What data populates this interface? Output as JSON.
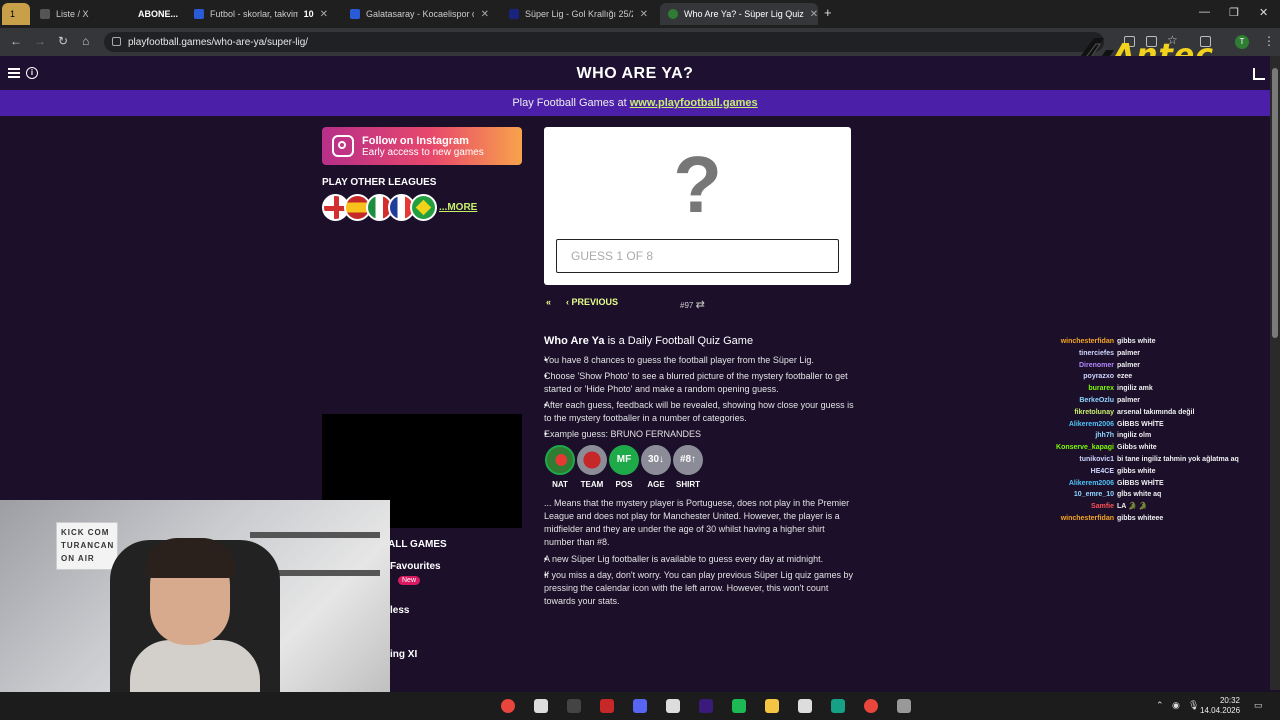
{
  "browser": {
    "tabs": [
      {
        "label": "1",
        "fav_color": "#ffb300",
        "title": "Liste / X",
        "has_close": false
      },
      {
        "label": "ABONE...",
        "fav_color": "#444",
        "title": "",
        "has_close": false
      },
      {
        "label": "Futbol - skorlar, takvim & c",
        "fav_color": "#2a5bd7",
        "title": "10",
        "has_close": true
      },
      {
        "label": "Galatasaray - Kocaelispor canlı",
        "fav_color": "#2a5bd7",
        "title": "",
        "has_close": true
      },
      {
        "label": "Süper Lig - Gol Krallığı 25/26 | T",
        "fav_color": "#1a237e",
        "title": "",
        "has_close": true
      },
      {
        "label": "Who Are Ya? - Süper Lig Quiz",
        "fav_color": "#2e7d32",
        "title": "",
        "has_close": true
      }
    ],
    "new_tab": "+",
    "url": "playfootball.games/who-are-ya/super-lig/",
    "profile_initial": "T",
    "window_controls": [
      "—",
      "❐",
      "✕"
    ]
  },
  "site": {
    "title": "WHO ARE YA?",
    "promo_prefix": "Play Football Games at ",
    "promo_link": "www.playfootball.games"
  },
  "left": {
    "insta_title": "Follow on Instagram",
    "insta_sub": "Early access to new games",
    "leagues_title": "PLAY OTHER LEAGUES",
    "more": "...MORE",
    "all_games": "ALL GAMES",
    "favourites": "Favourites",
    "new_badge": "New",
    "less": "less",
    "ing_xi": "ing XI"
  },
  "webcam": {
    "sign_lines": [
      "KICK COM",
      "TURANCAN",
      "ON AIR"
    ]
  },
  "game": {
    "mystery": "?",
    "guess_placeholder": "GUESS 1 OF 8",
    "previous": "PREVIOUS",
    "puzzle_number": "#97"
  },
  "article": {
    "heading_bold": "Who Are Ya",
    "heading_rest": " is a Daily Football Quiz Game",
    "bullets": [
      "You have 8 chances to guess the football player from the Süper Lig.",
      "Choose 'Show Photo' to see a blurred picture of the mystery footballer to get started or 'Hide Photo' and make a random opening guess.",
      "After each guess, feedback will be revealed, showing how close your guess is to the mystery footballer in a number of categories.",
      "Example guess: BRUNO FERNANDES"
    ],
    "badges": [
      {
        "text": "",
        "caption": "NAT",
        "color": "#1faa4a"
      },
      {
        "text": "",
        "caption": "TEAM",
        "color": "#8c8c99"
      },
      {
        "text": "MF",
        "caption": "POS",
        "color": "#1faa4a"
      },
      {
        "text": "30↓",
        "caption": "AGE",
        "color": "#8c8c99"
      },
      {
        "text": "#8↑",
        "caption": "SHIRT",
        "color": "#8c8c99"
      }
    ],
    "explanation": "... Means that the mystery player is Portuguese, does not play in the Premier League and does not play for Manchester United. However, the player is a midfielder and they are under the age of 30 whilst having a higher shirt number than #8.",
    "bullets2": [
      "A new Süper Lig footballer is available to guess every day at midnight.",
      "If you miss a day, don't worry. You can play previous Süper Lig quiz games by pressing the calendar icon with the left arrow. However, this won't count towards your stats."
    ]
  },
  "chat": [
    {
      "user": "winchesterfidan",
      "msg": "gibbs white",
      "color": "#f5a623"
    },
    {
      "user": "tinerciefes",
      "msg": "palmer",
      "color": "#cfd8ff"
    },
    {
      "user": "Direnomer",
      "msg": "palmer",
      "color": "#b388ff"
    },
    {
      "user": "poyrazxo",
      "msg": "ezee",
      "color": "#cfd8ff"
    },
    {
      "user": "burarex",
      "msg": "ingiliz amk",
      "color": "#7cfc00"
    },
    {
      "user": "BerkeOzlu",
      "msg": "palmer",
      "color": "#8fd6ff"
    },
    {
      "user": "fikretolunay",
      "msg": "arsenal takımında değil",
      "color": "#c7f06a"
    },
    {
      "user": "Alikerem2006",
      "msg": "GİBBS WHİTE",
      "color": "#4fc3f7"
    },
    {
      "user": "jhh7h",
      "msg": "ingiliz olm",
      "color": "#8fd6ff"
    },
    {
      "user": "Konserve_kapagi",
      "msg": "Gibbs white",
      "color": "#7cfc00"
    },
    {
      "user": "tunikovic1",
      "msg": "bi tane ingiliz tahmin yok ağlatma aq",
      "color": "#cfd8ff"
    },
    {
      "user": "HE4CE",
      "msg": "gibbs white",
      "color": "#cfd8ff"
    },
    {
      "user": "Alikerem2006",
      "msg": "GİBBS WHİTE",
      "color": "#4fc3f7"
    },
    {
      "user": "10_emre_10",
      "msg": "gİbs white aq",
      "color": "#8fd6ff"
    },
    {
      "user": "Samfie",
      "msg": "LA 🐊 🐊",
      "color": "#ff5252"
    },
    {
      "user": "winchesterfidan",
      "msg": "gibbs whiteee",
      "color": "#f5a623"
    }
  ],
  "watermark": "Antec",
  "taskbar": {
    "time": "20:32",
    "date": "14.04.2026",
    "icons": [
      "chrome-icon",
      "stream-icon",
      "obs-icon",
      "app-icon",
      "discord-icon",
      "stream-icon",
      "premiere-icon",
      "spotify-icon",
      "folder-icon",
      "stream-icon",
      "terminal-icon",
      "chrome-icon",
      "app-icon"
    ]
  }
}
